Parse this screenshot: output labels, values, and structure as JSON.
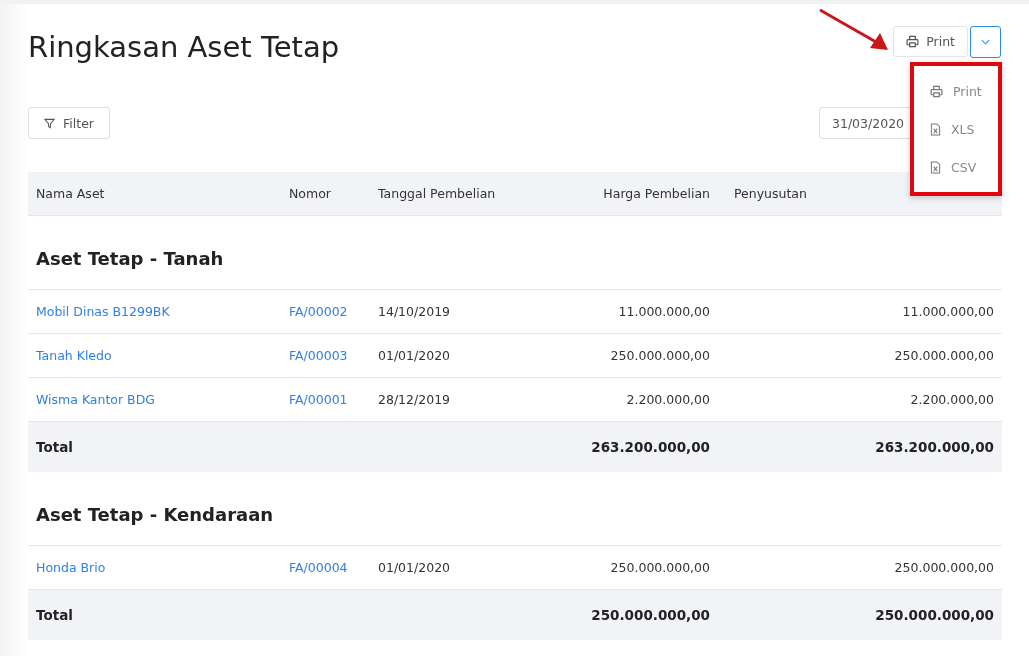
{
  "page": {
    "title": "Ringkasan Aset Tetap"
  },
  "toolbar": {
    "print_button": "Print",
    "filter_button": "Filter",
    "date_field": {
      "value": "31/03/2020"
    }
  },
  "print_menu": {
    "expanded": true,
    "items": [
      {
        "label": "Print",
        "kind": "print"
      },
      {
        "label": "XLS",
        "kind": "file"
      },
      {
        "label": "CSV",
        "kind": "file"
      }
    ]
  },
  "table": {
    "columns": [
      "Nama Aset",
      "Nomor",
      "Tanggal Pembelian",
      "Harga Pembelian",
      "Penyusutan"
    ],
    "groups": [
      {
        "title": "Aset Tetap - Tanah",
        "rows": [
          {
            "name": "Mobil Dinas B1299BK",
            "number": "FA/00002",
            "date": "14/10/2019",
            "price": "11.000.000,00",
            "book_value": "11.000.000,00"
          },
          {
            "name": "Tanah Kledo",
            "number": "FA/00003",
            "date": "01/01/2020",
            "price": "250.000.000,00",
            "book_value": "250.000.000,00"
          },
          {
            "name": "Wisma Kantor BDG",
            "number": "FA/00001",
            "date": "28/12/2019",
            "price": "2.200.000,00",
            "book_value": "2.200.000,00"
          }
        ],
        "total": {
          "label": "Total",
          "price": "263.200.000,00",
          "book_value": "263.200.000,00"
        }
      },
      {
        "title": "Aset Tetap - Kendaraan",
        "rows": [
          {
            "name": "Honda Brio",
            "number": "FA/00004",
            "date": "01/01/2020",
            "price": "250.000.000,00",
            "book_value": "250.000.000,00"
          }
        ],
        "total": {
          "label": "Total",
          "price": "250.000.000,00",
          "book_value": "250.000.000,00"
        }
      }
    ]
  }
}
